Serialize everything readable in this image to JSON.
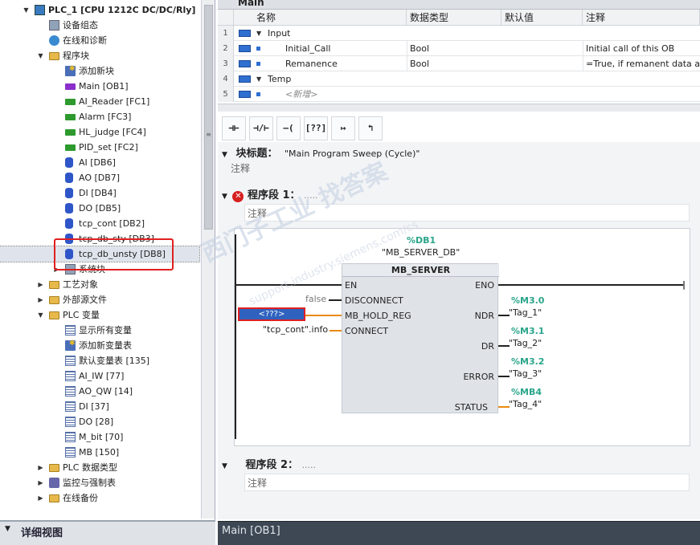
{
  "project_tree": {
    "items": [
      {
        "label": "PLC_1 [CPU 1212C DC/DC/Rly]",
        "icon": "cpu-icon",
        "indent": 0,
        "toggle": "▼",
        "bold": true
      },
      {
        "label": "设备组态",
        "icon": "device-config-icon",
        "indent": 1,
        "toggle": ""
      },
      {
        "label": "在线和诊断",
        "icon": "online-diagnostics-icon",
        "indent": 1,
        "toggle": ""
      },
      {
        "label": "程序块",
        "icon": "folder-icon",
        "indent": 1,
        "toggle": "▼"
      },
      {
        "label": "添加新块",
        "icon": "add-block-icon",
        "indent": 2,
        "toggle": ""
      },
      {
        "label": "Main [OB1]",
        "icon": "ob-block-icon",
        "indent": 2,
        "toggle": ""
      },
      {
        "label": "AI_Reader [FC1]",
        "icon": "fc-block-icon",
        "indent": 2,
        "toggle": ""
      },
      {
        "label": "Alarm [FC3]",
        "icon": "fc-block-icon",
        "indent": 2,
        "toggle": ""
      },
      {
        "label": "HL_judge [FC4]",
        "icon": "fc-block-icon",
        "indent": 2,
        "toggle": ""
      },
      {
        "label": "PID_set [FC2]",
        "icon": "fc-block-icon",
        "indent": 2,
        "toggle": ""
      },
      {
        "label": "AI [DB6]",
        "icon": "db-block-icon",
        "indent": 2,
        "toggle": ""
      },
      {
        "label": "AO [DB7]",
        "icon": "db-block-icon",
        "indent": 2,
        "toggle": ""
      },
      {
        "label": "DI [DB4]",
        "icon": "db-block-icon",
        "indent": 2,
        "toggle": ""
      },
      {
        "label": "DO [DB5]",
        "icon": "db-block-icon",
        "indent": 2,
        "toggle": ""
      },
      {
        "label": "tcp_cont [DB2]",
        "icon": "db-block-icon",
        "indent": 2,
        "toggle": ""
      },
      {
        "label": "tcp_db_sty [DB3]",
        "icon": "db-block-icon",
        "indent": 2,
        "toggle": ""
      },
      {
        "label": "tcp_db_unsty [DB8]",
        "icon": "db-block-icon",
        "indent": 2,
        "toggle": "",
        "selected": true
      },
      {
        "label": "系统块",
        "icon": "system-block-icon",
        "indent": 2,
        "toggle": "▶"
      },
      {
        "label": "工艺对象",
        "icon": "folder-icon",
        "indent": 1,
        "toggle": "▶"
      },
      {
        "label": "外部源文件",
        "icon": "folder-icon",
        "indent": 1,
        "toggle": "▶"
      },
      {
        "label": "PLC 变量",
        "icon": "folder-icon",
        "indent": 1,
        "toggle": "▼"
      },
      {
        "label": "显示所有变量",
        "icon": "tag-table-icon",
        "indent": 2,
        "toggle": ""
      },
      {
        "label": "添加新变量表",
        "icon": "add-tag-table-icon",
        "indent": 2,
        "toggle": ""
      },
      {
        "label": "默认变量表 [135]",
        "icon": "tag-table-icon",
        "indent": 2,
        "toggle": ""
      },
      {
        "label": "AI_IW [77]",
        "icon": "tag-table-icon",
        "indent": 2,
        "toggle": ""
      },
      {
        "label": "AO_QW [14]",
        "icon": "tag-table-icon",
        "indent": 2,
        "toggle": ""
      },
      {
        "label": "DI [37]",
        "icon": "tag-table-icon",
        "indent": 2,
        "toggle": ""
      },
      {
        "label": "DO [28]",
        "icon": "tag-table-icon",
        "indent": 2,
        "toggle": ""
      },
      {
        "label": "M_bit [70]",
        "icon": "tag-table-icon",
        "indent": 2,
        "toggle": ""
      },
      {
        "label": "MB [150]",
        "icon": "tag-table-icon",
        "indent": 2,
        "toggle": ""
      },
      {
        "label": "PLC 数据类型",
        "icon": "folder-icon",
        "indent": 1,
        "toggle": "▶"
      },
      {
        "label": "监控与强制表",
        "icon": "monitor-icon",
        "indent": 1,
        "toggle": "▶"
      },
      {
        "label": "在线备份",
        "icon": "folder-icon",
        "indent": 1,
        "toggle": "▶"
      }
    ]
  },
  "detail_view": {
    "toggle": "▼",
    "label": "详细视图"
  },
  "interface": {
    "title": "Main",
    "headers": {
      "name": "名称",
      "type": "数据类型",
      "default": "默认值",
      "comment": "注释"
    },
    "rows": [
      {
        "no": "1",
        "name": "Input",
        "type": "",
        "default": "",
        "comment": "",
        "level": 0
      },
      {
        "no": "2",
        "name": "Initial_Call",
        "type": "Bool",
        "default": "",
        "comment": "Initial call of this OB",
        "level": 1
      },
      {
        "no": "3",
        "name": "Remanence",
        "type": "Bool",
        "default": "",
        "comment": "=True, if remanent data are",
        "level": 1
      },
      {
        "no": "4",
        "name": "Temp",
        "type": "",
        "default": "",
        "comment": "",
        "level": 0
      },
      {
        "no": "5",
        "name": "<新增>",
        "type": "",
        "default": "",
        "comment": "",
        "level": 1
      }
    ]
  },
  "toolbar": {
    "buttons": [
      "⊣⊢",
      "⊣/⊢",
      "–( )–",
      "[??]",
      "↦",
      "↰"
    ]
  },
  "block": {
    "title_label": "块标题：",
    "title_value": "\"Main Program Sweep (Cycle)\"",
    "comment": "注释",
    "network1": {
      "label": "程序段 1：",
      "dots": ".....",
      "comment": "注释",
      "instance_addr": "%DB1",
      "instance_name": "\"MB_SERVER_DB\"",
      "fb_name": "MB_SERVER",
      "in_pins": [
        "EN",
        "DISCONNECT",
        "MB_HOLD_REG",
        "CONNECT"
      ],
      "in_values": {
        "disconnect": "false",
        "hold_reg": "<???>",
        "connect": "\"tcp_cont\".info"
      },
      "out_pins": [
        "ENO",
        "NDR",
        "DR",
        "ERROR",
        "STATUS"
      ],
      "outputs": [
        {
          "addr": "%M3.0",
          "tag": "\"Tag_1\""
        },
        {
          "addr": "%M3.1",
          "tag": "\"Tag_2\""
        },
        {
          "addr": "%M3.2",
          "tag": "\"Tag_3\""
        },
        {
          "addr": "%MB4",
          "tag": "\"Tag_4\""
        }
      ]
    },
    "network2": {
      "label": "程序段 2：",
      "dots": ".....",
      "comment": "注释"
    }
  },
  "status_tab": "Main [OB1]",
  "watermark": "西门子工业 找答案",
  "watermark2": "support.industry.siemens.com/cs",
  "colors": {
    "highlight": "#e02020",
    "address": "#2aa58a",
    "wire_param": "#e98a10"
  }
}
